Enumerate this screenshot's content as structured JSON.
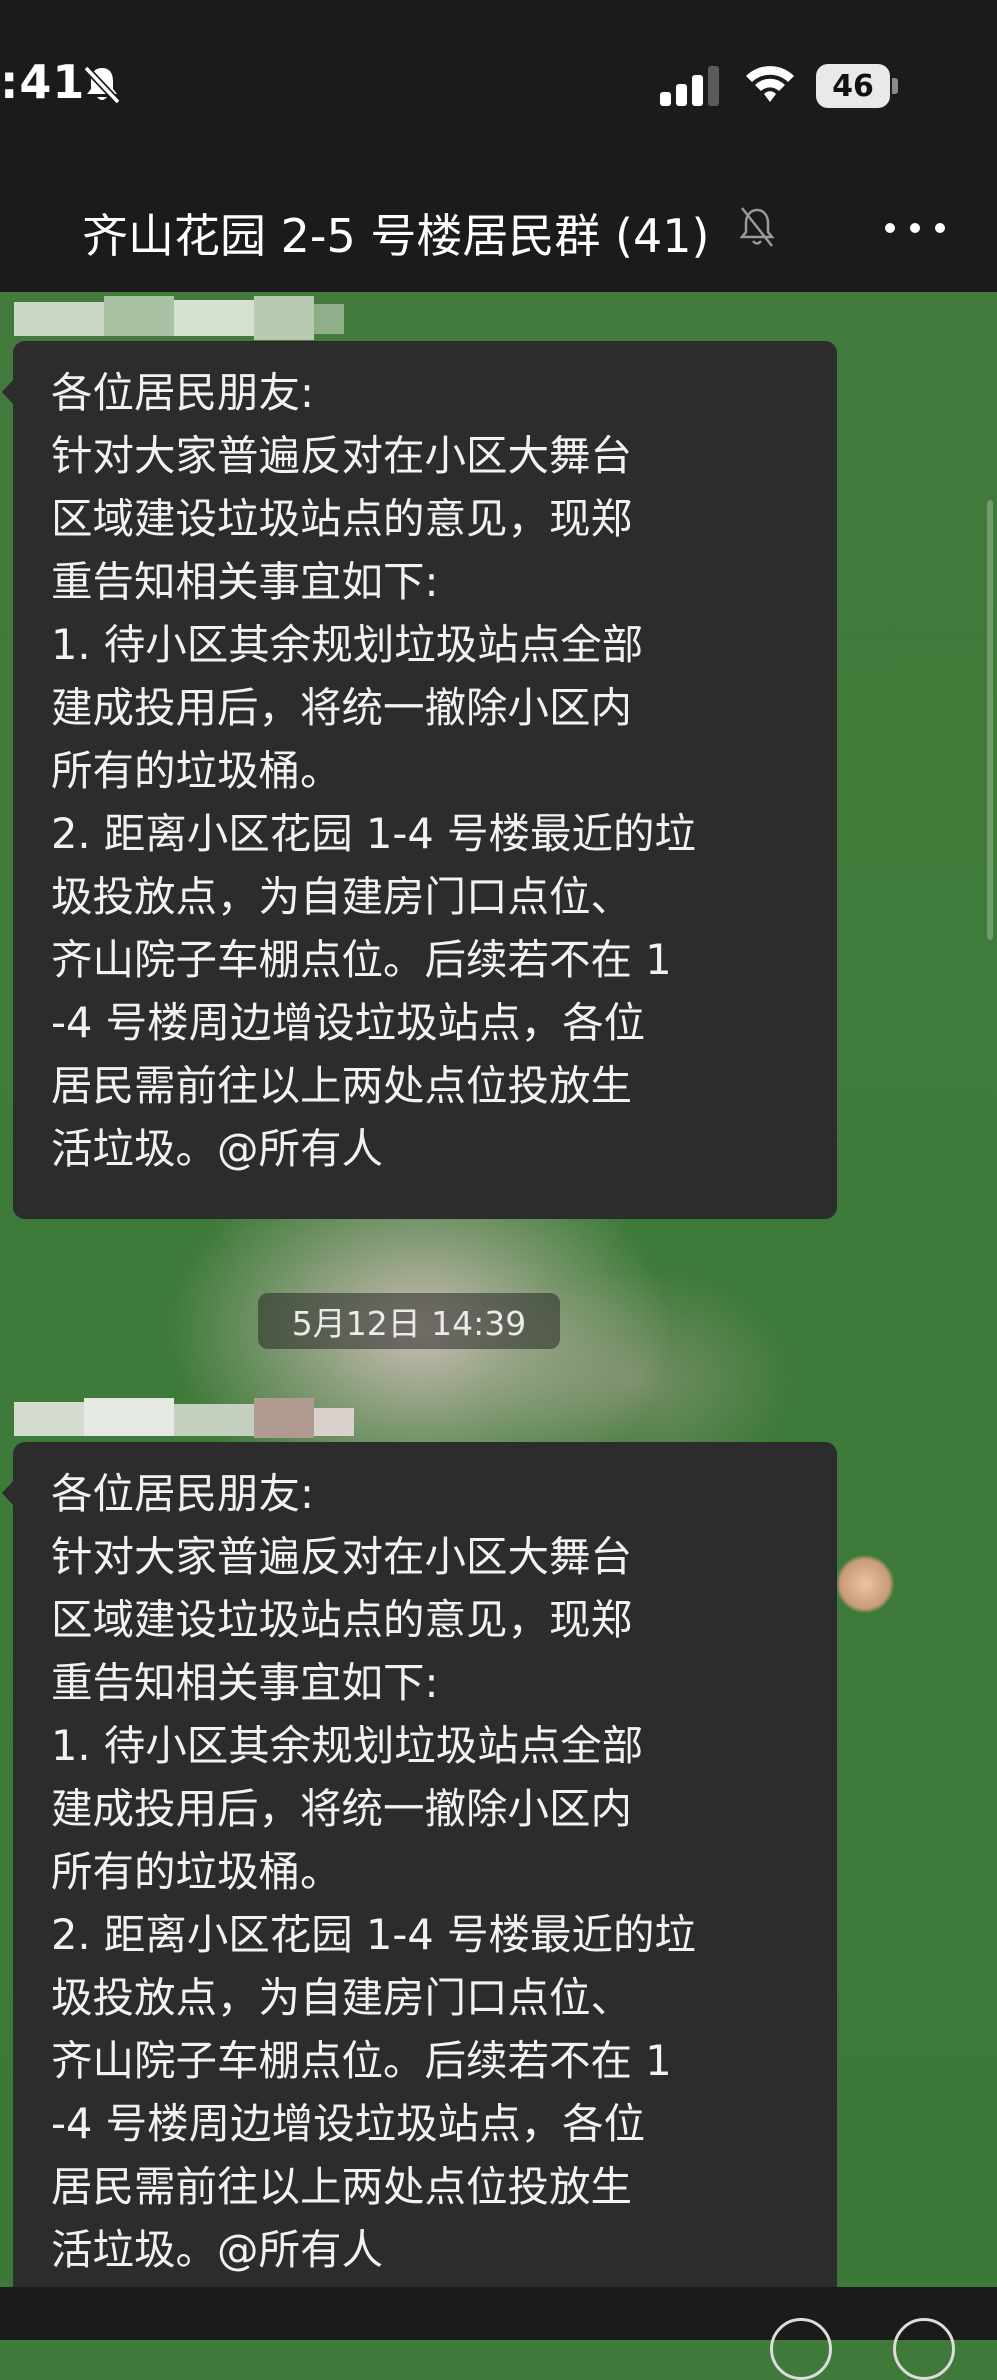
{
  "status_bar": {
    "time": ":41",
    "battery": "46"
  },
  "header": {
    "title": "齐山花园 2-5 号楼居民群 (41)"
  },
  "messages": [
    {
      "lines": [
        "各位居民朋友:",
        "针对大家普遍反对在小区大舞台",
        "区域建设垃圾站点的意见，现郑",
        "重告知相关事宜如下:",
        "1. 待小区其余规划垃圾站点全部",
        "建成投用后，将统一撤除小区内",
        "所有的垃圾桶。",
        "2. 距离小区花园 1-4 号楼最近的垃",
        "圾投放点，为自建房门口点位、",
        "齐山院子车棚点位。后续若不在 1",
        "-4 号楼周边增设垃圾站点，各位",
        "居民需前往以上两处点位投放生",
        "活垃圾。@所有人"
      ]
    },
    {
      "lines": [
        "各位居民朋友:",
        "针对大家普遍反对在小区大舞台",
        "区域建设垃圾站点的意见，现郑",
        "重告知相关事宜如下:",
        "1. 待小区其余规划垃圾站点全部",
        "建成投用后，将统一撤除小区内",
        "所有的垃圾桶。",
        "2. 距离小区花园 1-4 号楼最近的垃",
        "圾投放点，为自建房门口点位、",
        "齐山院子车棚点位。后续若不在 1",
        "-4 号楼周边增设垃圾站点，各位",
        "居民需前往以上两处点位投放生",
        "活垃圾。@所有人"
      ]
    }
  ],
  "timestamp": "5月12日 14:39",
  "icons": {
    "status": [
      "bell-off-icon",
      "signal-icon",
      "wifi-icon"
    ],
    "header": [
      "mute-icon",
      "more-icon"
    ]
  }
}
